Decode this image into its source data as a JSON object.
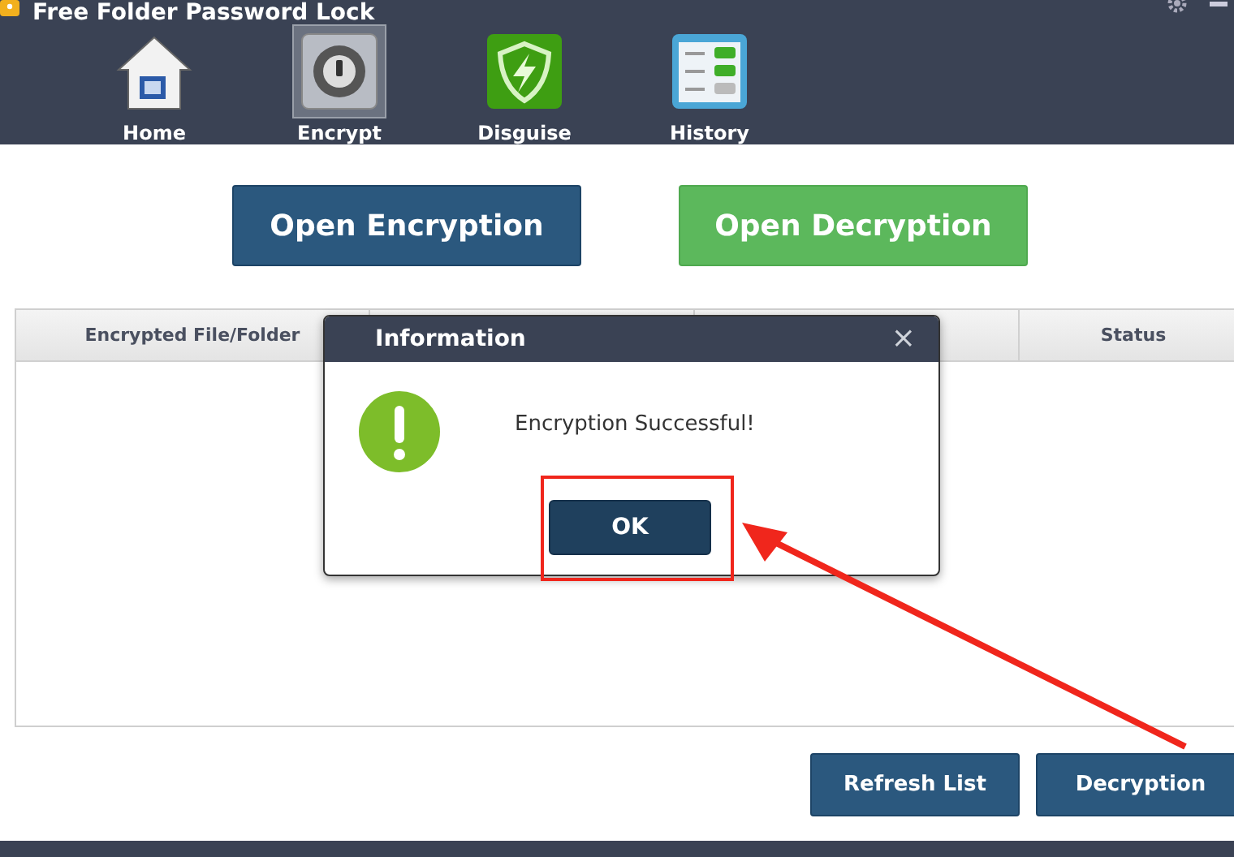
{
  "window": {
    "title": "Free Folder Password Lock"
  },
  "nav": [
    {
      "label": "Home",
      "kind": "home",
      "selected": false
    },
    {
      "label": "Encrypt",
      "kind": "encrypt",
      "selected": true
    },
    {
      "label": "Disguise",
      "kind": "disguise",
      "selected": false
    },
    {
      "label": "History",
      "kind": "history",
      "selected": false
    }
  ],
  "actions": [
    {
      "label": "Open Encryption",
      "kind": "primary"
    },
    {
      "label": "Open Decryption",
      "kind": "success"
    }
  ],
  "table": {
    "columns": [
      "Encrypted File/Folder",
      "Status"
    ]
  },
  "footer_buttons": [
    "Refresh List",
    "Decryption"
  ],
  "dialog": {
    "title": "Information",
    "close": "×",
    "message": "Encryption Successful!",
    "button": "OK"
  }
}
